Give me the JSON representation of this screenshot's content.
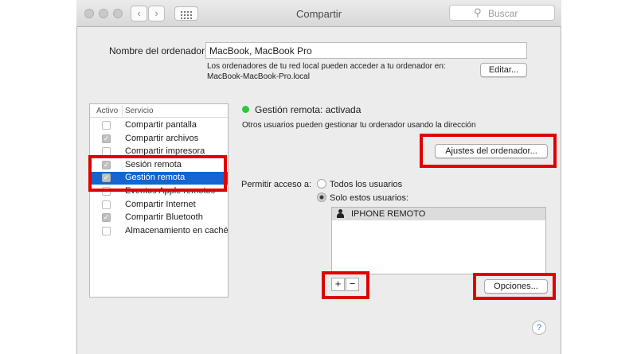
{
  "window": {
    "title": "Compartir"
  },
  "toolbar": {
    "back_icon": "chevron-left-icon",
    "forward_icon": "chevron-right-icon",
    "grid_icon": "grid-icon",
    "search_placeholder": "Buscar"
  },
  "computer_name": {
    "label": "Nombre del ordenador:",
    "value": "MacBook, MacBook Pro",
    "info_line1": "Los ordenadores de tu red local pueden acceder a tu ordenador en:",
    "info_line2": "MacBook-MacBook-Pro.local",
    "edit_button": "Editar..."
  },
  "services": {
    "col_active": "Activo",
    "col_service": "Servicio",
    "items": [
      {
        "name": "Compartir pantalla",
        "checked": false,
        "selected": false
      },
      {
        "name": "Compartir archivos",
        "checked": true,
        "selected": false
      },
      {
        "name": "Compartir impresora",
        "checked": false,
        "selected": false
      },
      {
        "name": "Sesión remota",
        "checked": true,
        "selected": false
      },
      {
        "name": "Gestión remota",
        "checked": true,
        "selected": true
      },
      {
        "name": "Eventos Apple remotos",
        "checked": false,
        "selected": false
      },
      {
        "name": "Compartir Internet",
        "checked": false,
        "selected": false
      },
      {
        "name": "Compartir Bluetooth",
        "checked": true,
        "selected": false
      },
      {
        "name": "Almacenamiento en caché",
        "checked": false,
        "selected": false
      }
    ]
  },
  "detail": {
    "status": "Gestión remota: activada",
    "status_color": "#28c840",
    "description": "Otros usuarios pueden gestionar tu ordenador usando la dirección",
    "settings_button": "Ajustes del ordenador...",
    "access_label": "Permitir acceso a:",
    "radio_all": "Todos los usuarios",
    "radio_only": "Solo estos usuarios:",
    "selected_radio": "radio_only",
    "users": [
      "IPHONE REMOTO"
    ],
    "add_label": "+",
    "remove_label": "−",
    "options_button": "Opciones...",
    "help_label": "?"
  },
  "highlight_color": "#e00000"
}
